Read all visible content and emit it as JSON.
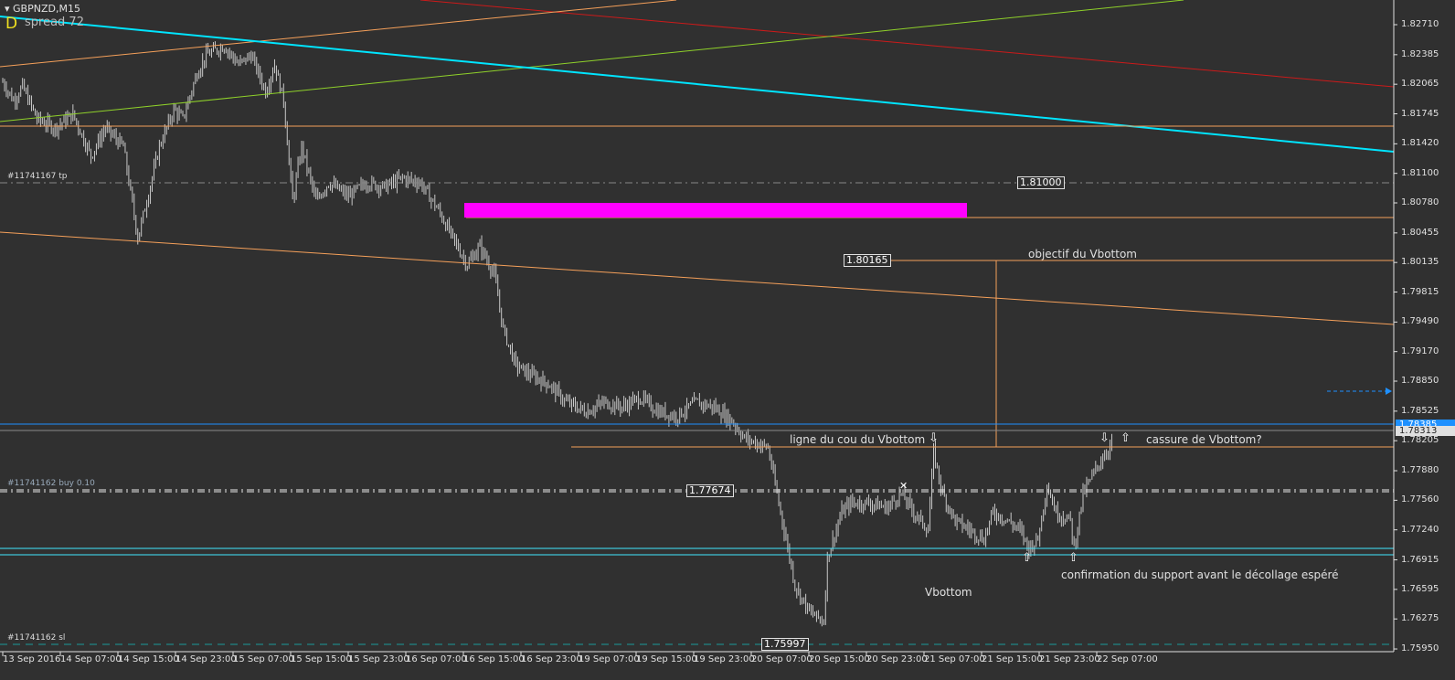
{
  "window": {
    "title": "GBPNZD,M15",
    "spread_badge": "D",
    "spread_text": "spread 72"
  },
  "colors": {
    "background": "#303030",
    "bars": "#c8c8c8",
    "trend_cyan": "#00e5ff",
    "orange": "#f5a05a",
    "magenta": "#ff00ff",
    "red": "#cc1a1a",
    "green": "#8fd12a",
    "blue": "#1e90ff"
  },
  "price_axis": [
    "1.82710",
    "1.82385",
    "1.82065",
    "1.81745",
    "1.81420",
    "1.81100",
    "1.80780",
    "1.80455",
    "1.80135",
    "1.79815",
    "1.79490",
    "1.79170",
    "1.78850",
    "1.78525",
    "1.78205",
    "1.77880",
    "1.77560",
    "1.77240",
    "1.76915",
    "1.76595",
    "1.76275",
    "1.75950"
  ],
  "current_prices": {
    "ask": "1.78385",
    "bid": "1.78313"
  },
  "time_axis": [
    "13 Sep 2016",
    "14 Sep 07:00",
    "14 Sep 15:00",
    "14 Sep 23:00",
    "15 Sep 07:00",
    "15 Sep 15:00",
    "15 Sep 23:00",
    "16 Sep 07:00",
    "16 Sep 15:00",
    "16 Sep 23:00",
    "19 Sep 07:00",
    "19 Sep 15:00",
    "19 Sep 23:00",
    "20 Sep 07:00",
    "20 Sep 15:00",
    "20 Sep 23:00",
    "21 Sep 07:00",
    "21 Sep 15:00",
    "21 Sep 23:00",
    "22 Sep 07:00"
  ],
  "orders": {
    "tp_tag": "#11741167 tp",
    "buy_tag": "#11741162 buy 0.10",
    "sl_tag": "#11741162 sl"
  },
  "price_boxes": {
    "tp": "1.81000",
    "target": "1.80165",
    "entry": "1.77674",
    "sl": "1.75997"
  },
  "annotations": {
    "target": "objectif du Vbottom",
    "neckline": "ligne du cou du Vbottom",
    "breakout": "cassure de Vbottom?",
    "vbottom": "Vbottom",
    "support": "confirmation du support avant le décollage espéré"
  },
  "chart_data": {
    "type": "ohlc",
    "symbol": "GBPNZD",
    "timeframe": "M15",
    "ylim": [
      1.759,
      1.828
    ],
    "price_path_bar_index": [
      0,
      6,
      11,
      19,
      29,
      39,
      49,
      57,
      67,
      75,
      80,
      87,
      95,
      100,
      108,
      113,
      123,
      131,
      138,
      146,
      151,
      156,
      161,
      166,
      174,
      181,
      192,
      202,
      212,
      222,
      232,
      242,
      250,
      258,
      265,
      273,
      278,
      285,
      293,
      303,
      313,
      324,
      334,
      344,
      354,
      364,
      374,
      385,
      395,
      405,
      412,
      425,
      430,
      435,
      440,
      448,
      456,
      458,
      466,
      471,
      481,
      491,
      499,
      506,
      514,
      517,
      522,
      529,
      537,
      545,
      550,
      558,
      565,
      570,
      575,
      580,
      585,
      593,
      595,
      600,
      608,
      616
    ],
    "price_path_close": [
      1.8209,
      1.8189,
      1.8204,
      1.8169,
      1.8159,
      1.8174,
      1.8129,
      1.8159,
      1.8139,
      1.804,
      1.808,
      1.8139,
      1.8179,
      1.8169,
      1.8219,
      1.8238,
      1.8248,
      1.8228,
      1.8238,
      1.8199,
      1.8228,
      1.8189,
      1.808,
      1.8139,
      1.808,
      1.81,
      1.8085,
      1.81,
      1.8095,
      1.8105,
      1.81,
      1.807,
      1.804,
      1.8011,
      1.8031,
      1.8001,
      1.7941,
      1.7902,
      1.7892,
      1.7882,
      1.7862,
      1.7852,
      1.7862,
      1.7857,
      1.7867,
      1.7852,
      1.7847,
      1.7862,
      1.7857,
      1.7842,
      1.7823,
      1.7813,
      1.7763,
      1.7714,
      1.7664,
      1.7635,
      1.7625,
      1.7694,
      1.7743,
      1.7753,
      1.7753,
      1.7748,
      1.7763,
      1.7743,
      1.7724,
      1.7808,
      1.7763,
      1.7734,
      1.7724,
      1.7714,
      1.7743,
      1.7734,
      1.7724,
      1.7704,
      1.7714,
      1.7773,
      1.7743,
      1.7734,
      1.7704,
      1.7763,
      1.7793,
      1.7818
    ],
    "levels": {
      "tp": 1.81,
      "target": 1.80165,
      "neckline": 1.78205,
      "entry": 1.77674,
      "sl": 1.75997
    }
  }
}
